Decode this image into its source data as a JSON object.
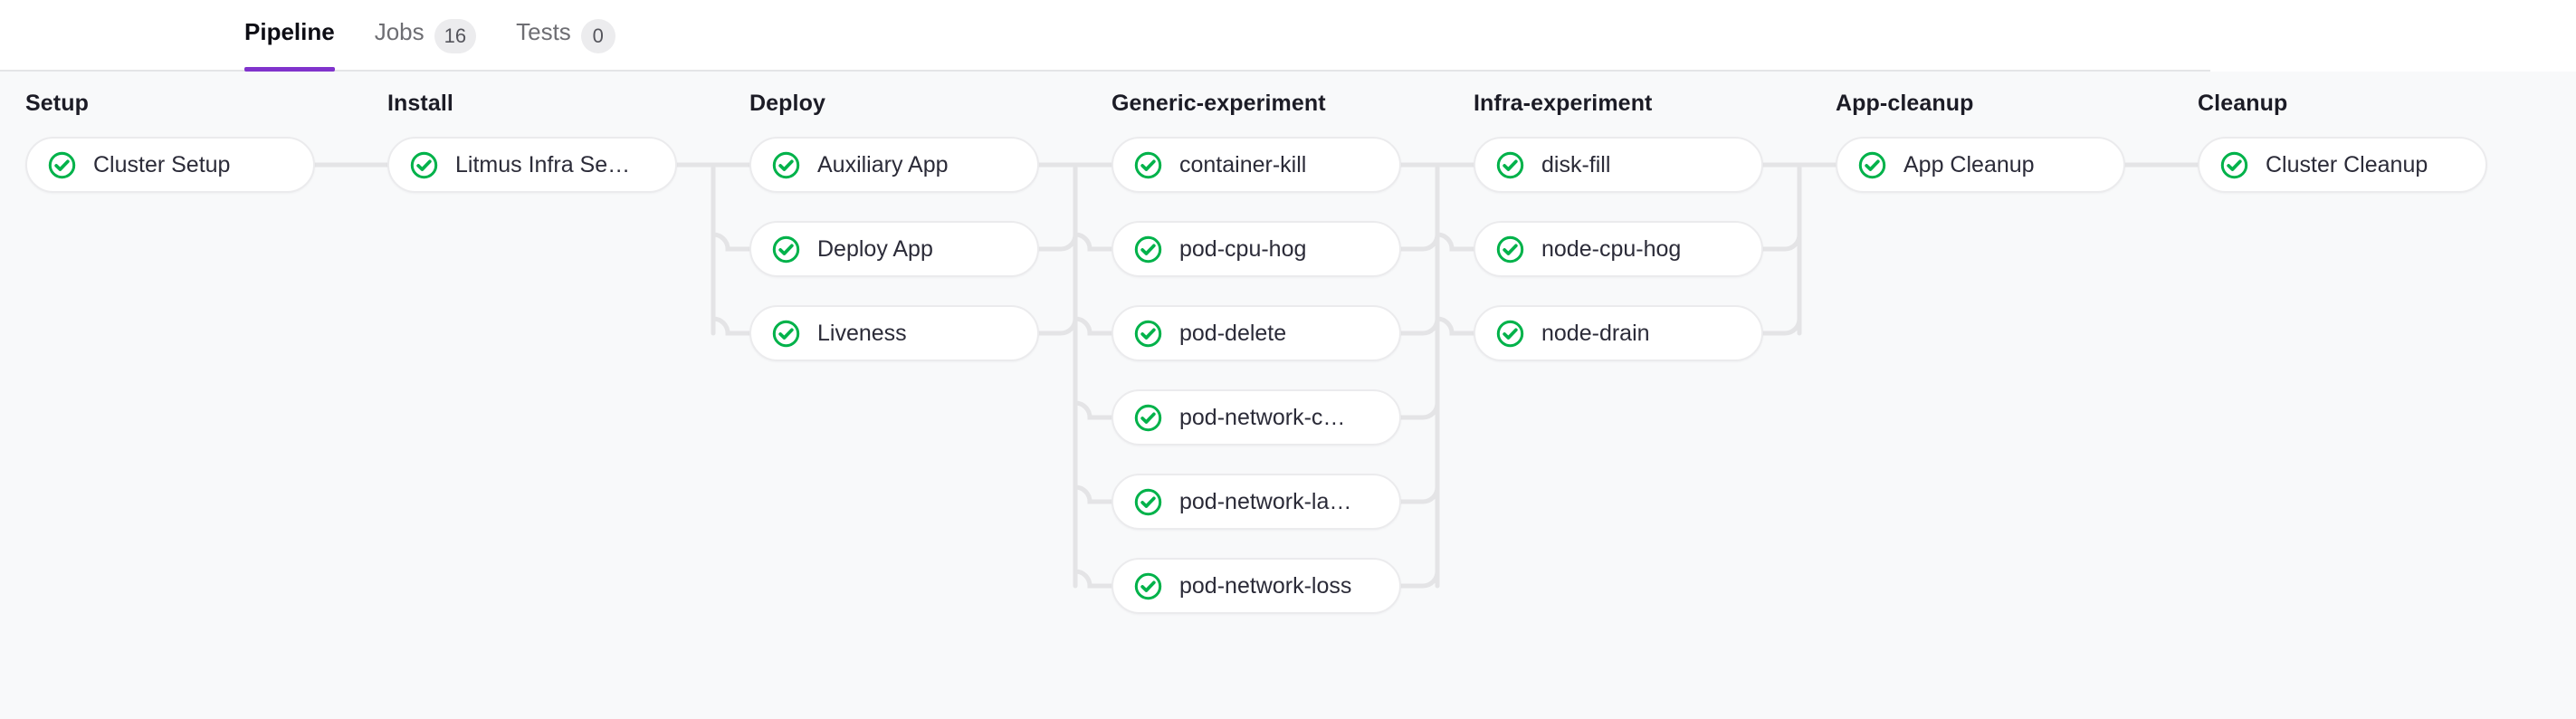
{
  "tabs": [
    {
      "label": "Pipeline",
      "count": null,
      "active": true,
      "name": "tab-pipeline"
    },
    {
      "label": "Jobs",
      "count": "16",
      "active": false,
      "name": "tab-jobs"
    },
    {
      "label": "Tests",
      "count": "0",
      "active": false,
      "name": "tab-tests"
    }
  ],
  "colors": {
    "accent": "#8033cc",
    "success": "#00b24a",
    "edge": "#e4e4e6",
    "node_border": "#ebebed",
    "canvas_bg": "#f8f9fa",
    "header_bg": "#ffffff",
    "text": "#2b2b38",
    "title_text": "#1c1c26",
    "muted_text": "#6e6e73"
  },
  "pipeline": {
    "status_icon": "check-circle-icon",
    "stages": [
      {
        "title": "Setup",
        "name": "stage-setup",
        "nodes": [
          {
            "label": "Cluster Setup",
            "status": "success"
          }
        ]
      },
      {
        "title": "Install",
        "name": "stage-install",
        "nodes": [
          {
            "label": "Litmus Infra Se…",
            "status": "success"
          }
        ]
      },
      {
        "title": "Deploy",
        "name": "stage-deploy",
        "nodes": [
          {
            "label": "Auxiliary App",
            "status": "success"
          },
          {
            "label": "Deploy App",
            "status": "success"
          },
          {
            "label": "Liveness",
            "status": "success"
          }
        ]
      },
      {
        "title": "Generic-experiment",
        "name": "stage-generic-experiment",
        "nodes": [
          {
            "label": "container-kill",
            "status": "success"
          },
          {
            "label": "pod-cpu-hog",
            "status": "success"
          },
          {
            "label": "pod-delete",
            "status": "success"
          },
          {
            "label": "pod-network-c…",
            "status": "success"
          },
          {
            "label": "pod-network-la…",
            "status": "success"
          },
          {
            "label": "pod-network-loss",
            "status": "success"
          }
        ]
      },
      {
        "title": "Infra-experiment",
        "name": "stage-infra-experiment",
        "nodes": [
          {
            "label": "disk-fill",
            "status": "success"
          },
          {
            "label": "node-cpu-hog",
            "status": "success"
          },
          {
            "label": "node-drain",
            "status": "success"
          }
        ]
      },
      {
        "title": "App-cleanup",
        "name": "stage-app-cleanup",
        "nodes": [
          {
            "label": "App Cleanup",
            "status": "success"
          }
        ]
      },
      {
        "title": "Cleanup",
        "name": "stage-cleanup",
        "nodes": [
          {
            "label": "Cluster Cleanup",
            "status": "success"
          }
        ]
      }
    ]
  }
}
